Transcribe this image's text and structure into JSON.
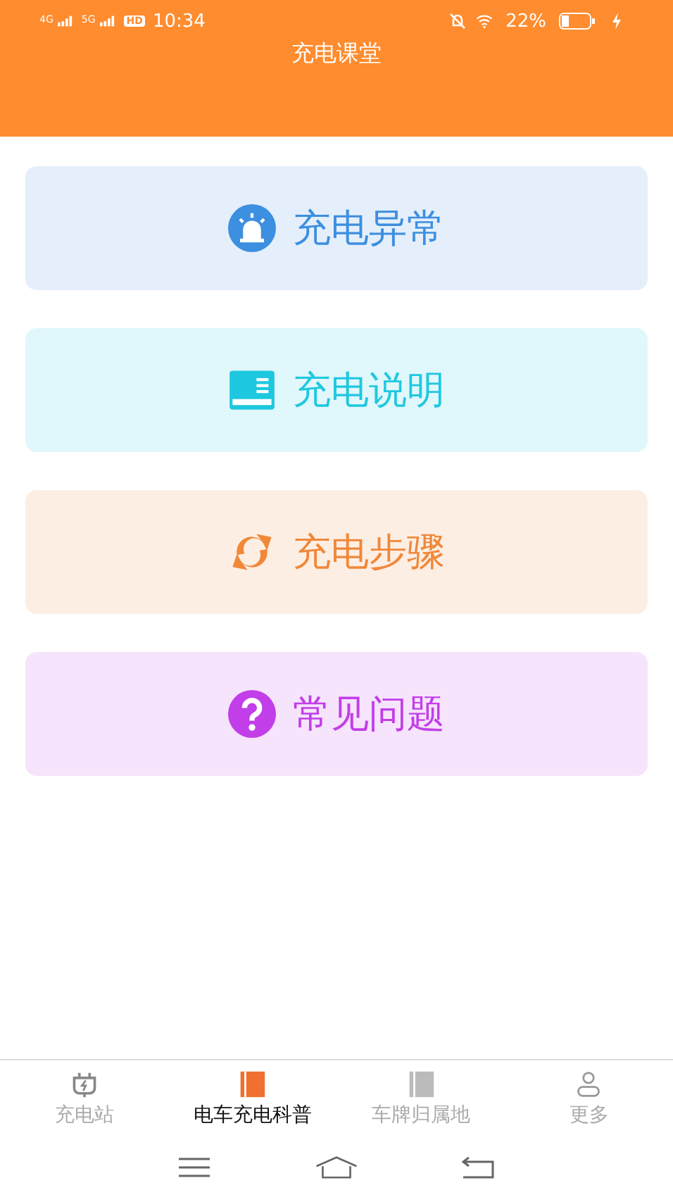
{
  "status_bar": {
    "network_1": "4G",
    "network_2": "5G",
    "hd": "HD",
    "time": "10:34",
    "battery": "22%"
  },
  "header": {
    "title": "充电课堂"
  },
  "cards": [
    {
      "kind": "alarm",
      "label": "充电异常",
      "color": "#3d8fe0"
    },
    {
      "kind": "book",
      "label": "充电说明",
      "color": "#1ec8e0"
    },
    {
      "kind": "cycle",
      "label": "充电步骤",
      "color": "#f0883a"
    },
    {
      "kind": "question",
      "label": "常见问题",
      "color": "#c23ee8"
    }
  ],
  "tabs": [
    {
      "kind": "plug",
      "label": "充电站",
      "selected": false
    },
    {
      "kind": "book",
      "label": "电车充电科普",
      "selected": true
    },
    {
      "kind": "book",
      "label": "车牌归属地",
      "selected": false
    },
    {
      "kind": "person",
      "label": "更多",
      "selected": false
    }
  ]
}
